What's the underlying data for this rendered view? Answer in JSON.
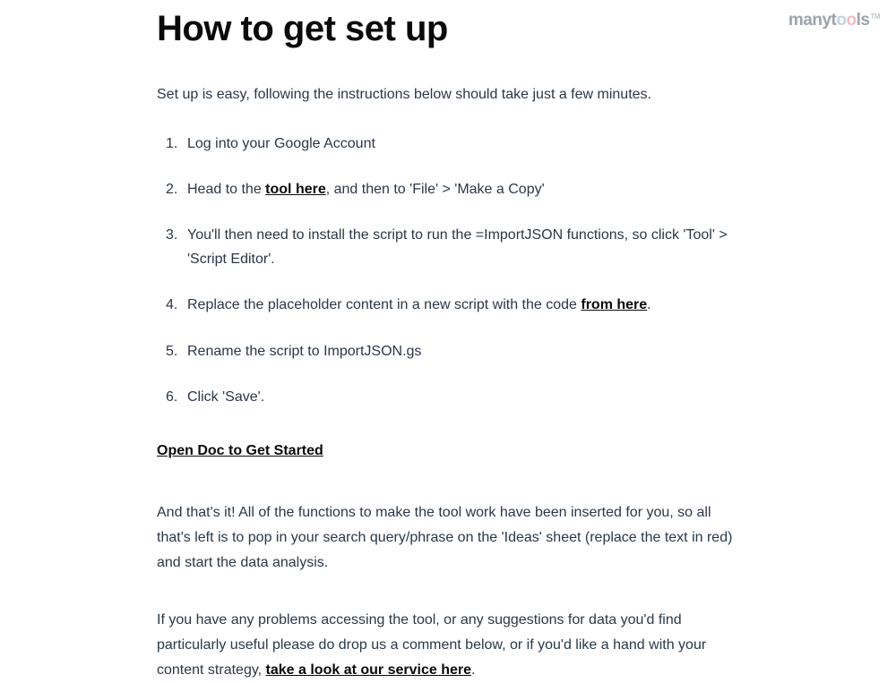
{
  "logo": {
    "part1": "manyt",
    "accent1": "o",
    "accent2": "o",
    "part2": "ls",
    "tm": "TM"
  },
  "heading": "How to get set up",
  "intro": "Set up is easy, following the instructions below should take just a few minutes.",
  "steps": {
    "s1": "Log into your Google Account",
    "s2_before": "Head to the ",
    "s2_link": "tool here",
    "s2_after": ", and then to 'File' > 'Make a Copy'",
    "s3": "You'll then need to install the script to run the =ImportJSON functions, so click 'Tool' > 'Script Editor'.",
    "s4_before": "Replace the placeholder content in a new script with the code ",
    "s4_link": "from here",
    "s4_after": ".",
    "s5": "Rename the script to ImportJSON.gs",
    "s6": "Click 'Save'."
  },
  "cta": "Open Doc to Get Started",
  "para1": "And that's it! All of the functions to make the tool work have been inserted for you, so all that's left is to pop in your search query/phrase on the 'Ideas' sheet (replace the text in red) and start the data analysis.",
  "para2_before": "If you have any problems accessing the tool, or any suggestions for data you'd find particularly useful please do drop us a comment below, or if you'd like a hand with your content strategy, ",
  "para2_link": "take a look at our service here",
  "para2_after": "."
}
